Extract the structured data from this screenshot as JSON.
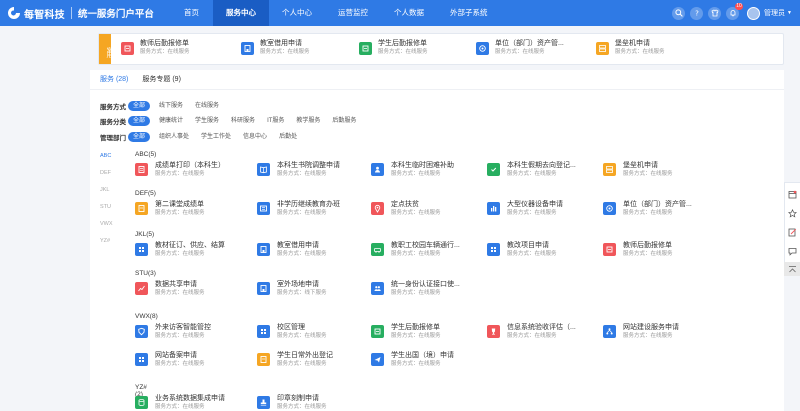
{
  "header": {
    "logo_text": "每智科技",
    "platform": "统一服务门户平台",
    "nav": [
      "首页",
      "服务中心",
      "个人中心",
      "运营监控",
      "个人数据",
      "外部子系统"
    ],
    "active_nav": 1,
    "badge_count": "10",
    "user": "管理员"
  },
  "frequent": {
    "tag": "常用",
    "items": [
      {
        "title": "教师后勤报修单",
        "sub": "服务方式：在线服务",
        "icon": "repair-icon",
        "color": "#f0565a"
      },
      {
        "title": "教室借用申请",
        "sub": "服务方式：在线服务",
        "icon": "building-icon",
        "color": "#2f7ae5"
      },
      {
        "title": "学生后勤报修单",
        "sub": "服务方式：在线服务",
        "icon": "repair-icon",
        "color": "#27ae60"
      },
      {
        "title": "单位（部门）资产管...",
        "sub": "服务方式：在线服务",
        "icon": "asset-icon",
        "color": "#2f7ae5"
      },
      {
        "title": "堡垒机申请",
        "sub": "服务方式：在线服务",
        "icon": "server-icon",
        "color": "#f5a623"
      }
    ]
  },
  "tabs": [
    {
      "label": "服务 (28)"
    },
    {
      "label": "服务专题 (9)"
    }
  ],
  "filters": [
    {
      "label": "服务方式",
      "options": [
        "全部",
        "线下服务",
        "在线服务"
      ]
    },
    {
      "label": "服务分类",
      "options": [
        "全部",
        "健康统计",
        "学生服务",
        "科研服务",
        "IT服务",
        "教学服务",
        "后勤服务"
      ]
    },
    {
      "label": "管理部门",
      "options": [
        "全部",
        "组织人事处",
        "学生工作处",
        "信息中心",
        "后勤处"
      ]
    }
  ],
  "alpha": [
    "ABC",
    "DEF",
    "JKL",
    "STU",
    "VWX",
    "YZ#"
  ],
  "groups": [
    {
      "title": "ABC(5)",
      "items": [
        {
          "title": "成绩单打印（本科生）",
          "sub": "服务方式：在线服务",
          "icon": "print-icon",
          "color": "#f0565a"
        },
        {
          "title": "本科生书院调整申请",
          "sub": "服务方式：在线服务",
          "icon": "book-icon",
          "color": "#2f7ae5"
        },
        {
          "title": "本科生临时困难补助",
          "sub": "服务方式：在线服务",
          "icon": "support-icon",
          "color": "#2f7ae5"
        },
        {
          "title": "本科生假期去向登记...",
          "sub": "服务方式：在线服务",
          "icon": "register-icon",
          "color": "#27ae60"
        },
        {
          "title": "堡垒机申请",
          "sub": "服务方式：在线服务",
          "icon": "server-icon",
          "color": "#f5a623"
        }
      ]
    },
    {
      "title": "DEF(5)",
      "items": [
        {
          "title": "第二课堂成绩单",
          "sub": "服务方式：在线服务",
          "icon": "document-icon",
          "color": "#f5a623"
        },
        {
          "title": "非学历继续教育办班",
          "sub": "服务方式：在线服务",
          "icon": "education-icon",
          "color": "#2f7ae5"
        },
        {
          "title": "定点扶贫",
          "sub": "服务方式：在线服务",
          "icon": "location-icon",
          "color": "#f0565a"
        },
        {
          "title": "大型仪器设备申请",
          "sub": "服务方式：在线服务",
          "icon": "chart-icon",
          "color": "#2f7ae5"
        },
        {
          "title": "单位（部门）资产管...",
          "sub": "服务方式：在线服务",
          "icon": "asset-icon",
          "color": "#2f7ae5"
        }
      ]
    },
    {
      "title": "JKL(5)",
      "items": [
        {
          "title": "教材征订、供应、结算",
          "sub": "服务方式：在线服务",
          "icon": "grid-icon",
          "color": "#2f7ae5"
        },
        {
          "title": "教室借用申请",
          "sub": "服务方式：在线服务",
          "icon": "building-icon",
          "color": "#2f7ae5"
        },
        {
          "title": "教职工校园车辆通行...",
          "sub": "服务方式：在线服务",
          "icon": "car-icon",
          "color": "#27ae60"
        },
        {
          "title": "教改项目申请",
          "sub": "服务方式：在线服务",
          "icon": "grid-icon",
          "color": "#2f7ae5"
        },
        {
          "title": "教师后勤报修单",
          "sub": "服务方式：在线服务",
          "icon": "repair-icon",
          "color": "#f0565a"
        }
      ]
    },
    {
      "title": "STU(3)",
      "items": [
        {
          "title": "数据共享申请",
          "sub": "服务方式：在线服务",
          "icon": "trend-icon",
          "color": "#f0565a"
        },
        {
          "title": "室外场地申请",
          "sub": "服务方式：线下服务",
          "icon": "building-icon",
          "color": "#2f7ae5"
        },
        {
          "title": "统一身份认证接口使...",
          "sub": "服务方式：在线服务",
          "icon": "users-icon",
          "color": "#2f7ae5"
        }
      ]
    },
    {
      "title": "VWX(8)",
      "items": [
        {
          "title": "外来访客智能管控",
          "sub": "服务方式：在线服务",
          "icon": "shield-icon",
          "color": "#2f7ae5"
        },
        {
          "title": "校区管理",
          "sub": "服务方式：在线服务",
          "icon": "grid-icon",
          "color": "#2f7ae5"
        },
        {
          "title": "学生后勤报修单",
          "sub": "服务方式：在线服务",
          "icon": "repair-icon",
          "color": "#27ae60"
        },
        {
          "title": "信息系统验收评估（...",
          "sub": "服务方式：在线服务",
          "icon": "trophy-icon",
          "color": "#f0565a"
        },
        {
          "title": "网站建设服务申请",
          "sub": "服务方式：在线服务",
          "icon": "network-icon",
          "color": "#2f7ae5"
        },
        {
          "title": "网站备案申请",
          "sub": "服务方式：在线服务",
          "icon": "grid-icon",
          "color": "#2f7ae5"
        },
        {
          "title": "学生日常外出登记",
          "sub": "服务方式：在线服务",
          "icon": "document-icon",
          "color": "#f5a623"
        },
        {
          "title": "学生出国（境）申请",
          "sub": "服务方式：在线服务",
          "icon": "plane-icon",
          "color": "#2f7ae5"
        }
      ]
    },
    {
      "title": "YZ#(2)",
      "items": [
        {
          "title": "业务系统数据集成申请",
          "sub": "服务方式：在线服务",
          "icon": "database-icon",
          "color": "#27ae60"
        },
        {
          "title": "印章刻制申请",
          "sub": "服务方式：在线服务",
          "icon": "stamp-icon",
          "color": "#2f7ae5"
        }
      ]
    }
  ]
}
